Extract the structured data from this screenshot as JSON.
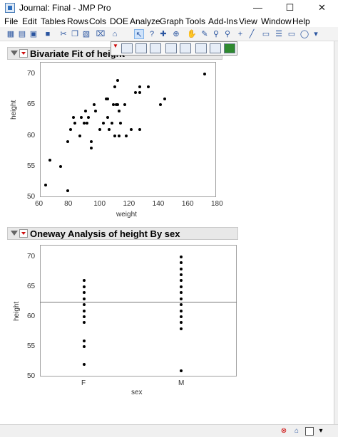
{
  "window": {
    "title": "Journal: Final - JMP Pro",
    "minimize": "—",
    "maximize": "☐",
    "close": "✕"
  },
  "menu": [
    "File",
    "Edit",
    "Tables",
    "Rows",
    "Cols",
    "DOE",
    "Analyze",
    "Graph",
    "Tools",
    "Add-Ins",
    "View",
    "Window",
    "Help"
  ],
  "bivariate": {
    "header": "Bivariate Fit of height",
    "chart_data": {
      "type": "scatter",
      "xlabel": "weight",
      "ylabel": "height",
      "xlim": [
        60,
        180
      ],
      "ylim": [
        50,
        72
      ],
      "xticks": [
        "60",
        "80",
        "100",
        "120",
        "140",
        "160",
        "180"
      ],
      "yticks": [
        "50",
        "55",
        "60",
        "65",
        "70"
      ],
      "points": [
        [
          64,
          52
        ],
        [
          67,
          56
        ],
        [
          74,
          55
        ],
        [
          79,
          51
        ],
        [
          79,
          59
        ],
        [
          81,
          61
        ],
        [
          83,
          63
        ],
        [
          84,
          62
        ],
        [
          87,
          60
        ],
        [
          88,
          63
        ],
        [
          90,
          62
        ],
        [
          91,
          64
        ],
        [
          92,
          62
        ],
        [
          93,
          63
        ],
        [
          95,
          59
        ],
        [
          95,
          58
        ],
        [
          97,
          65
        ],
        [
          98,
          64
        ],
        [
          101,
          61
        ],
        [
          103,
          62
        ],
        [
          105,
          66
        ],
        [
          106,
          63
        ],
        [
          106,
          66
        ],
        [
          107,
          61
        ],
        [
          109,
          62
        ],
        [
          110,
          65
        ],
        [
          111,
          68
        ],
        [
          111,
          60
        ],
        [
          112,
          65
        ],
        [
          113,
          69
        ],
        [
          113,
          65
        ],
        [
          114,
          64
        ],
        [
          114,
          60
        ],
        [
          115,
          62
        ],
        [
          118,
          65
        ],
        [
          119,
          60
        ],
        [
          122,
          61
        ],
        [
          125,
          67
        ],
        [
          128,
          68
        ],
        [
          128,
          67
        ],
        [
          128,
          61
        ],
        [
          134,
          68
        ],
        [
          142,
          65
        ],
        [
          145,
          66
        ],
        [
          172,
          70
        ]
      ]
    }
  },
  "oneway": {
    "header": "Oneway Analysis of height By sex",
    "chart_data": {
      "type": "scatter",
      "xlabel": "sex",
      "ylabel": "height",
      "categories": [
        "F",
        "M"
      ],
      "ylim": [
        50,
        72
      ],
      "yticks": [
        "50",
        "55",
        "60",
        "65",
        "70"
      ],
      "mean_line": 62.5,
      "series": [
        {
          "name": "F",
          "values": [
            52,
            55,
            56,
            59,
            60,
            61,
            62,
            63,
            64,
            65,
            66
          ]
        },
        {
          "name": "M",
          "values": [
            51,
            58,
            59,
            60,
            61,
            62,
            63,
            64,
            65,
            66,
            67,
            68,
            69,
            70
          ]
        }
      ]
    }
  }
}
